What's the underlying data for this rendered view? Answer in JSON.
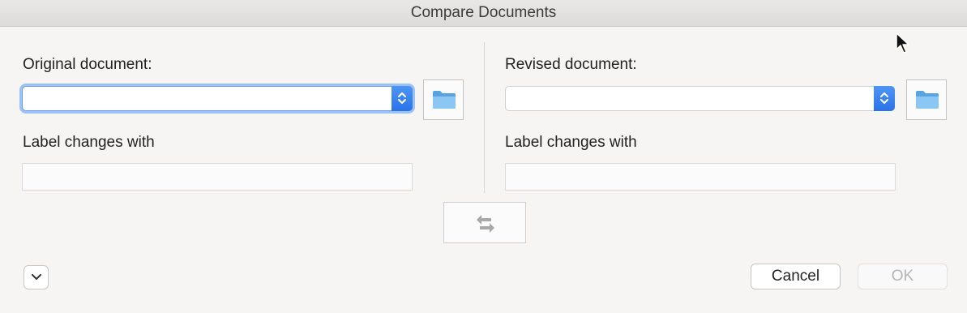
{
  "window": {
    "title": "Compare Documents"
  },
  "original": {
    "label": "Original document:",
    "document_value": "",
    "label_changes_label": "Label changes with",
    "label_changes_value": ""
  },
  "revised": {
    "label": "Revised document:",
    "document_value": "",
    "label_changes_label": "Label changes with",
    "label_changes_value": ""
  },
  "buttons": {
    "cancel": "Cancel",
    "ok": "OK"
  },
  "icons": {
    "browse": "folder-icon",
    "popup": "up-down-stepper-icon",
    "swap": "swap-arrows-icon",
    "disclosure": "chevron-down-icon",
    "cursor": "mouse-pointer-icon"
  },
  "colors": {
    "accent": "#2a73e8",
    "focus_ring": "#9cc1f3",
    "folder": "#6fb0e8"
  }
}
